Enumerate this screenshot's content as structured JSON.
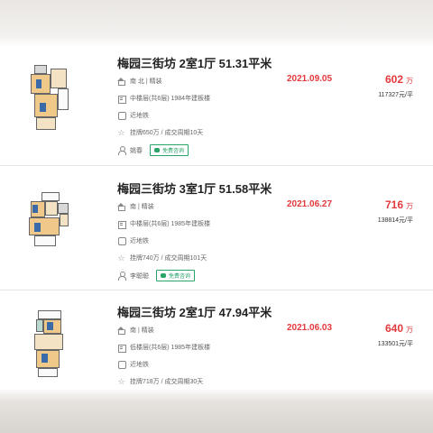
{
  "listings": [
    {
      "title": "梅园三街坊 2室1厅 51.31平米",
      "orientation": "南 北 | 精装",
      "floor": "中楼层(共6层) 1984年建板楼",
      "metro": "近地铁",
      "listing_info": "挂牌650万 / 成交周期10天",
      "agent": "姚春",
      "consult_label": "免费咨询",
      "date": "2021.09.05",
      "price": "602",
      "price_unit": "万",
      "unit_price": "117327元/平"
    },
    {
      "title": "梅园三街坊 3室1厅 51.58平米",
      "orientation": "南 | 精装",
      "floor": "中楼层(共6层) 1985年建板楼",
      "metro": "近地铁",
      "listing_info": "挂牌740万 / 成交周期101天",
      "agent": "李聪聪",
      "consult_label": "免费咨询",
      "date": "2021.06.27",
      "price": "716",
      "price_unit": "万",
      "unit_price": "138814元/平"
    },
    {
      "title": "梅园三街坊 2室1厅 47.94平米",
      "orientation": "南 | 精装",
      "floor": "低楼层(共6层) 1985年建板楼",
      "metro": "近地铁",
      "listing_info": "挂牌718万 / 成交周期30天",
      "date": "2021.06.03",
      "price": "640",
      "price_unit": "万",
      "unit_price": "133501元/平"
    }
  ],
  "colors": {
    "accent_red": "#e4393c",
    "consult_green": "#2aa56a"
  },
  "icons": [
    "house-icon",
    "building-icon",
    "metro-icon",
    "star-icon",
    "user-icon",
    "chat-icon"
  ]
}
